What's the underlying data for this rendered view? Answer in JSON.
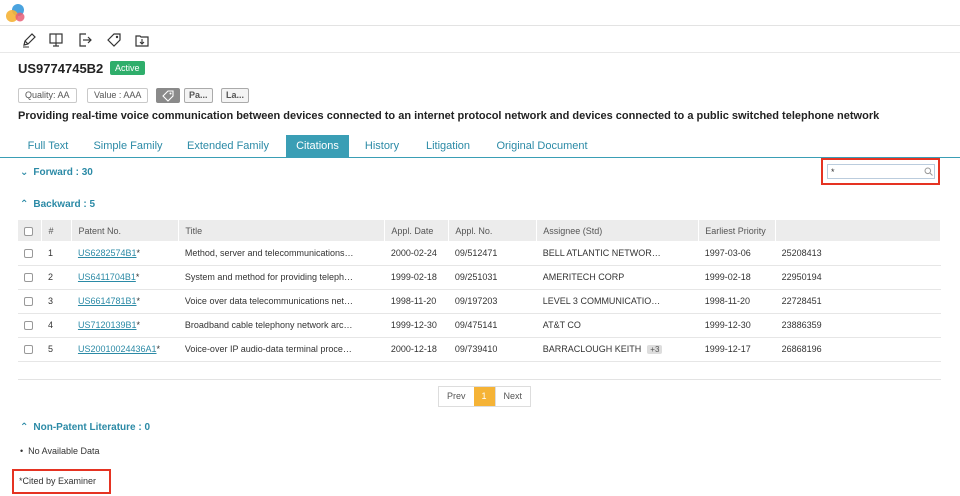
{
  "patent": {
    "number": "US9774745B2",
    "status": "Active",
    "quality": "Quality: AA",
    "value": "Value : AAA",
    "chips": [
      "Pa...",
      "La..."
    ],
    "title": "Providing real-time voice communication between devices connected to an internet protocol network and devices connected to a public switched telephone network"
  },
  "colors": {
    "accent": "#3a9eb5",
    "active_badge": "#2fae6b",
    "highlight": "#e53322",
    "page_current": "#f5b336"
  },
  "toolbar_icons": [
    "pencil-icon",
    "monitor-icon",
    "export-icon",
    "tag-icon",
    "save-to-folder-icon"
  ],
  "tabs": [
    {
      "label": "Full Text"
    },
    {
      "label": "Simple Family"
    },
    {
      "label": "Extended Family"
    },
    {
      "label": "Citations"
    },
    {
      "label": "History"
    },
    {
      "label": "Litigation"
    },
    {
      "label": "Original Document"
    }
  ],
  "forward": {
    "label": "Forward : 30"
  },
  "search": {
    "value": "*",
    "placeholder": ""
  },
  "backward": {
    "label": "Backward : 5",
    "columns": [
      "#",
      "Patent No.",
      "Title",
      "Appl. Date",
      "Appl. No.",
      "Assignee (Std)",
      "Earliest Priority"
    ],
    "rows": [
      {
        "idx": "1",
        "patent": "US6282574B1",
        "mark": "*",
        "title": "Method, server and telecommunications…",
        "appl_date": "2000-02-24",
        "appl_no": "09/512471",
        "assignee": "BELL ATLANTIC NETWOR…",
        "extra": "",
        "priority": "1997-03-06",
        "code": "25208413"
      },
      {
        "idx": "2",
        "patent": "US6411704B1",
        "mark": "*",
        "title": "System and method for providing teleph…",
        "appl_date": "1999-02-18",
        "appl_no": "09/251031",
        "assignee": "AMERITECH CORP",
        "extra": "",
        "priority": "1999-02-18",
        "code": "22950194"
      },
      {
        "idx": "3",
        "patent": "US6614781B1",
        "mark": "*",
        "title": "Voice over data telecommunications net…",
        "appl_date": "1998-11-20",
        "appl_no": "09/197203",
        "assignee": "LEVEL 3 COMMUNICATIO…",
        "extra": "",
        "priority": "1998-11-20",
        "code": "22728451"
      },
      {
        "idx": "4",
        "patent": "US7120139B1",
        "mark": "*",
        "title": "Broadband cable telephony network arc…",
        "appl_date": "1999-12-30",
        "appl_no": "09/475141",
        "assignee": "AT&T CO",
        "extra": "",
        "priority": "1999-12-30",
        "code": "23886359"
      },
      {
        "idx": "5",
        "patent": "US20010024436A1",
        "mark": "*",
        "title": "Voice-over IP audio-data terminal proce…",
        "appl_date": "2000-12-18",
        "appl_no": "09/739410",
        "assignee": "BARRACLOUGH KEITH",
        "extra": "+3",
        "priority": "1999-12-17",
        "code": "26868196"
      }
    ]
  },
  "pager": {
    "prev": "Prev",
    "current": "1",
    "next": "Next"
  },
  "npl": {
    "label": "Non-Patent Literature : 0",
    "empty": "No Available Data"
  },
  "note": "*Cited by Examiner"
}
